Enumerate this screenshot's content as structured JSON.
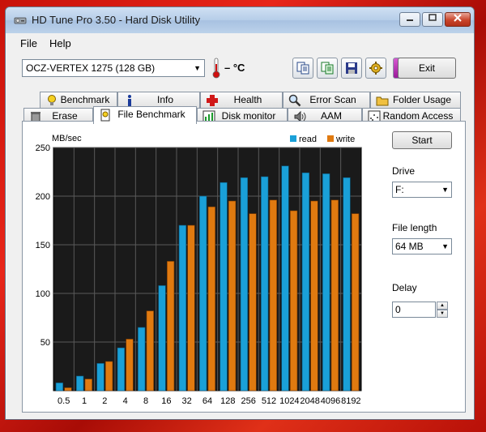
{
  "window": {
    "title": "HD Tune Pro 3.50 - Hard Disk Utility"
  },
  "menu": {
    "file": "File",
    "help": "Help"
  },
  "toolbar": {
    "drive": "OCZ-VERTEX 1275 (128 GB)",
    "temperature": "– °C",
    "exit_label": "Exit",
    "icons": [
      "copy-text-icon",
      "copy-info-icon",
      "save-icon",
      "options-icon",
      "download-icon"
    ]
  },
  "tabs": {
    "row1": [
      "Benchmark",
      "Info",
      "Health",
      "Error Scan",
      "Folder Usage"
    ],
    "row2": [
      "Erase",
      "File Benchmark",
      "Disk monitor",
      "AAM",
      "Random Access"
    ],
    "active": "File Benchmark"
  },
  "controls": {
    "start_label": "Start",
    "drive_label": "Drive",
    "drive_value": "F:",
    "file_length_label": "File length",
    "file_length_value": "64 MB",
    "delay_label": "Delay",
    "delay_value": "0"
  },
  "colors": {
    "read": "#1aa0d8",
    "write": "#e07a10",
    "plot_bg": "#1a1a1a",
    "grid": "#5a5a5a"
  },
  "chart_data": {
    "type": "bar",
    "ylabel": "MB/sec",
    "ylim": [
      0,
      250
    ],
    "yticks": [
      50,
      100,
      150,
      200,
      250
    ],
    "categories": [
      "0.5",
      "1",
      "2",
      "4",
      "8",
      "16",
      "32",
      "64",
      "128",
      "256",
      "512",
      "1024",
      "2048",
      "4096",
      "8192"
    ],
    "series": [
      {
        "name": "read",
        "values": [
          8,
          15,
          28,
          44,
          65,
          108,
          170,
          200,
          214,
          219,
          220,
          231,
          224,
          223,
          219
        ]
      },
      {
        "name": "write",
        "values": [
          3,
          12,
          30,
          53,
          82,
          133,
          170,
          189,
          195,
          182,
          196,
          185,
          195,
          196,
          182
        ]
      }
    ],
    "legend": "top-right",
    "grid": true
  }
}
